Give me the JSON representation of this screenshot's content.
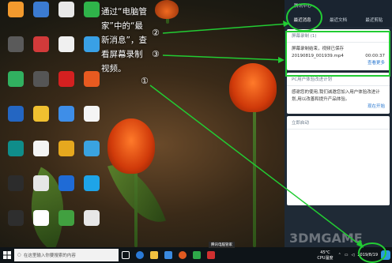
{
  "desktop_icons": [
    {
      "label": "",
      "color": "#f29a2e"
    },
    {
      "label": "",
      "color": "#3b7bd1"
    },
    {
      "label": "",
      "color": "#e8e8e8"
    },
    {
      "label": "",
      "color": "#2fb34a"
    },
    {
      "label": "",
      "color": "#5a5a5a"
    },
    {
      "label": "",
      "color": "#d23a3a"
    },
    {
      "label": "",
      "color": "#f0f0f0"
    },
    {
      "label": "",
      "color": "#39a0e6"
    },
    {
      "label": "",
      "color": "#31b060"
    },
    {
      "label": "",
      "color": "#555555"
    },
    {
      "label": "",
      "color": "#d42020"
    },
    {
      "label": "",
      "color": "#e85a20"
    },
    {
      "label": "",
      "color": "#2466c2"
    },
    {
      "label": "",
      "color": "#f0c030"
    },
    {
      "label": "",
      "color": "#3e8ee8"
    },
    {
      "label": "",
      "color": "#f5f5f5"
    },
    {
      "label": "",
      "color": "#0f8d8a"
    },
    {
      "label": "",
      "color": "#f4f4f4"
    },
    {
      "label": "",
      "color": "#e6a81e"
    },
    {
      "label": "",
      "color": "#3aa3e0"
    },
    {
      "label": "",
      "color": "#2c2c2c"
    },
    {
      "label": "",
      "color": "#e6e6e6"
    },
    {
      "label": "",
      "color": "#1f6bd6"
    },
    {
      "label": "",
      "color": "#1ea4e8"
    },
    {
      "label": "",
      "color": "#2e2e2e"
    },
    {
      "label": "",
      "color": "#ffffff"
    },
    {
      "label": "",
      "color": "#41a040"
    },
    {
      "label": "",
      "color": "#e7e7e7"
    }
  ],
  "annotation": {
    "text": "通过“电脑管家”中的“最新消息”，查看屏幕录制视频。",
    "marker_1": "①",
    "marker_2": "②",
    "marker_3": "③",
    "highlight_color": "#22cc33"
  },
  "panel": {
    "title": "腾讯中心",
    "tabs": [
      "最近消息",
      "最近文档",
      "最近剪贴"
    ],
    "active_tab": 0,
    "card1": {
      "header": "屏幕录制 (1)",
      "message": "屏幕录制结束，视频已保存",
      "file_name": "20190819_001939.mp4",
      "duration": "00:00:37",
      "more": "查看更多"
    },
    "card2": {
      "header": "PC用户体验改进计划",
      "body": "感谢您的使用,我们诚邀您加入用户体验改进计划,用以改善和提升产品体验。",
      "action": "现在开始"
    },
    "card3": {
      "header": "立即启动"
    }
  },
  "taskbar": {
    "search_placeholder": "在这里输入你要搜索的内容",
    "temperature": "45°C",
    "cpu_label": "CPU温度",
    "date": "2019/8/19",
    "tooltip": "腾讯电脑管家"
  },
  "watermark": "3DMGAME"
}
